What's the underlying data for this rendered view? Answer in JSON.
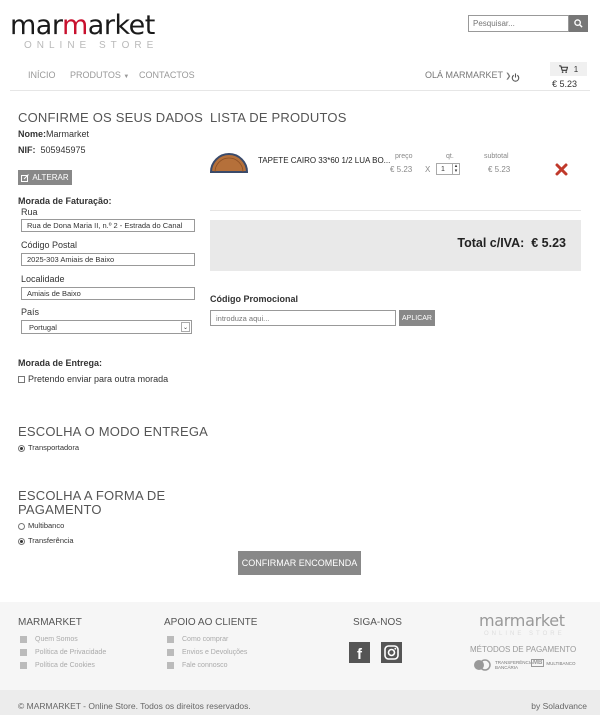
{
  "header": {
    "logo_main": "mar",
    "logo_red": "m",
    "logo_end": "arket",
    "logo_sub": "ONLINE STORE",
    "search_placeholder": "Pesquisar...",
    "nav": [
      "INÍCIO",
      "PRODUTOS",
      "CONTACTOS"
    ],
    "greeting": "OLÁ MARMARKET",
    "cart_count": "1",
    "cart_total": "€ 5.23"
  },
  "customer": {
    "title": "CONFIRME OS SEUS DADOS",
    "name_label": "Nome:",
    "name_value": "Marmarket",
    "nif_label": "NIF:",
    "nif_value": "505945975",
    "edit_button": "ALTERAR",
    "billing_title": "Morada de Faturação:",
    "rua_label": "Rua",
    "rua_value": "Rua de Dona Maria II, n.º 2 - Estrada do Canal",
    "cp_label": "Código Postal",
    "cp_value": "2025-303 Amiais de Baixo",
    "loc_label": "Localidade",
    "loc_value": "Amiais de Baixo",
    "country_label": "País",
    "country_value": "Portugal",
    "delivery_title": "Morada de Entrega:",
    "delivery_option": "Pretendo enviar para outra morada"
  },
  "shipping": {
    "title": "ESCOLHA O MODO ENTREGA",
    "option": "Transportadora"
  },
  "payment": {
    "title": "ESCOLHA A FORMA DE PAGAMENTO",
    "options": [
      "Multibanco",
      "Transferência"
    ],
    "selected_index": 1
  },
  "confirm_button": "CONFIRMAR ENCOMENDA",
  "products": {
    "title": "LISTA DE PRODUTOS",
    "price_header": "preço",
    "qty_header": "qt.",
    "subtotal_header": "subtotal",
    "items": [
      {
        "name": "TAPETE CAIRO 33*60 1/2 LUA BO...",
        "price": "€ 5.23",
        "qty": "1",
        "times": "X",
        "subtotal": "€ 5.23"
      }
    ],
    "total_label": "Total c/IVA:",
    "total_value": "€ 5.23",
    "promo_label": "Código Promocional",
    "promo_placeholder": "introduza aqui...",
    "promo_button": "APLICAR"
  },
  "footer": {
    "col1_title": "MARMARKET",
    "col1_links": [
      "Quem Somos",
      "Política de Privacidade",
      "Política de Cookies"
    ],
    "col2_title": "APOIO AO CLIENTE",
    "col2_links": [
      "Como comprar",
      "Envios e Devoluções",
      "Fale connosco"
    ],
    "col3_title": "SIGA-NOS",
    "logo_text": "marmarket",
    "logo_sub": "ONLINE STORE",
    "payment_title": "MÉTODOS DE PAGAMENTO",
    "pay_logos": [
      "TRANSFERÊNCIA BANCÁRIA",
      "MULTIBANCO"
    ],
    "copyright": "© MARMARKET - Online Store. Todos os direitos reservados.",
    "by": "by Soladvance"
  },
  "colors": {
    "brand_red": "#c8102e",
    "button_grey": "#888888",
    "delete_red": "#c0392b"
  }
}
